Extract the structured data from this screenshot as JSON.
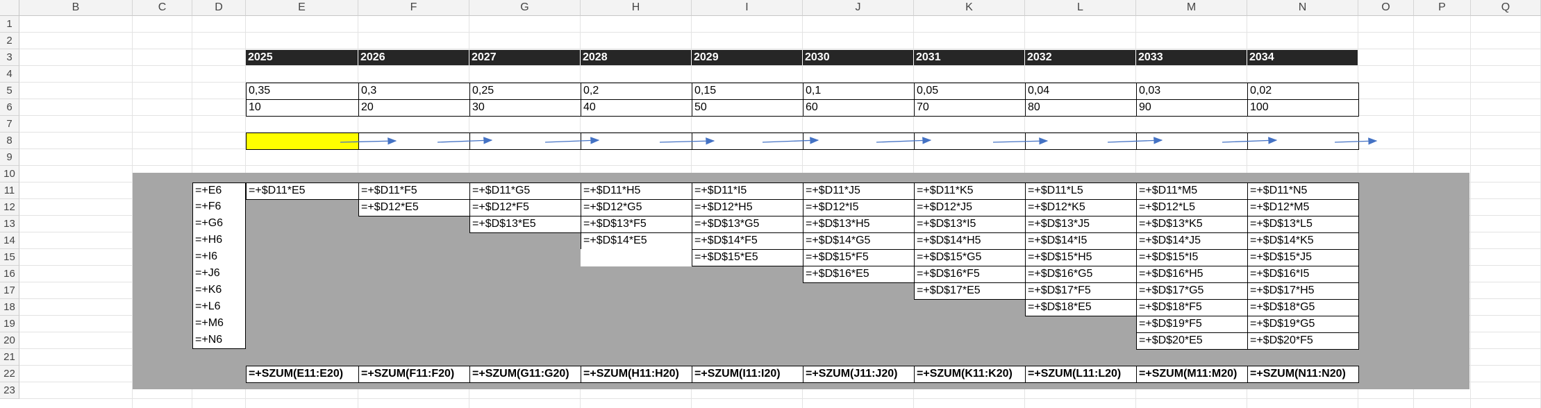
{
  "columns": [
    "B",
    "C",
    "D",
    "E",
    "F",
    "G",
    "H",
    "I",
    "J",
    "K",
    "L",
    "M",
    "N",
    "O",
    "P",
    "Q"
  ],
  "rows": [
    "1",
    "2",
    "3",
    "4",
    "5",
    "6",
    "7",
    "8",
    "9",
    "10",
    "11",
    "12",
    "13",
    "14",
    "15",
    "16",
    "17",
    "18",
    "19",
    "20",
    "21",
    "22",
    "23"
  ],
  "years": [
    "2025",
    "2026",
    "2027",
    "2028",
    "2029",
    "2030",
    "2031",
    "2032",
    "2033",
    "2034"
  ],
  "rates": [
    "0,35",
    "0,3",
    "0,25",
    "0,2",
    "0,15",
    "0,1",
    "0,05",
    "0,04",
    "0,03",
    "0,02"
  ],
  "amounts": [
    "10",
    "20",
    "30",
    "40",
    "50",
    "60",
    "70",
    "80",
    "90",
    "100"
  ],
  "highlight_color": "#ffff00",
  "arrow_color": "#4472c4",
  "d_column": [
    "=+E6",
    "=+F6",
    "=+G6",
    "=+H6",
    "=+I6",
    "=+J6",
    "=+K6",
    "=+L6",
    "=+M6",
    "=+N6"
  ],
  "matrix": [
    [
      "=+$D11*E5",
      "=+$D11*F5",
      "=+$D11*G5",
      "=+$D11*H5",
      "=+$D11*I5",
      "=+$D11*J5",
      "=+$D11*K5",
      "=+$D11*L5",
      "=+$D11*M5",
      "=+$D11*N5"
    ],
    [
      "",
      "=+$D12*E5",
      "=+$D12*F5",
      "=+$D12*G5",
      "=+$D12*H5",
      "=+$D12*I5",
      "=+$D12*J5",
      "=+$D12*K5",
      "=+$D12*L5",
      "=+$D12*M5"
    ],
    [
      "",
      "",
      "=+$D$13*E5",
      "=+$D$13*F5",
      "=+$D$13*G5",
      "=+$D$13*H5",
      "=+$D$13*I5",
      "=+$D$13*J5",
      "=+$D$13*K5",
      "=+$D$13*L5"
    ],
    [
      "",
      "",
      "",
      "=+$D$14*E5",
      "=+$D$14*F5",
      "=+$D$14*G5",
      "=+$D$14*H5",
      "=+$D$14*I5",
      "=+$D$14*J5",
      "=+$D$14*K5"
    ],
    [
      "",
      "",
      "",
      "",
      "=+$D$15*E5",
      "=+$D$15*F5",
      "=+$D$15*G5",
      "=+$D$15*H5",
      "=+$D$15*I5",
      "=+$D$15*J5"
    ],
    [
      "",
      "",
      "",
      "",
      "",
      "=+$D$16*E5",
      "=+$D$16*F5",
      "=+$D$16*G5",
      "=+$D$16*H5",
      "=+$D$16*I5"
    ],
    [
      "",
      "",
      "",
      "",
      "",
      "",
      "=+$D$17*E5",
      "=+$D$17*F5",
      "=+$D$17*G5",
      "=+$D$17*H5"
    ],
    [
      "",
      "",
      "",
      "",
      "",
      "",
      "",
      "=+$D$18*E5",
      "=+$D$18*F5",
      "=+$D$18*G5"
    ],
    [
      "",
      "",
      "",
      "",
      "",
      "",
      "",
      "",
      "=+$D$19*F5",
      "=+$D$19*G5"
    ],
    [
      "",
      "",
      "",
      "",
      "",
      "",
      "",
      "",
      "=+$D$20*E5",
      "=+$D$20*F5"
    ]
  ],
  "sums": [
    "=+SZUM(E11:E20)",
    "=+SZUM(F11:F20)",
    "=+SZUM(G11:G20)",
    "=+SZUM(H11:H20)",
    "=+SZUM(I11:I20)",
    "=+SZUM(J11:J20)",
    "=+SZUM(K11:K20)",
    "=+SZUM(L11:L20)",
    "=+SZUM(M11:M20)",
    "=+SZUM(N11:N20)"
  ]
}
